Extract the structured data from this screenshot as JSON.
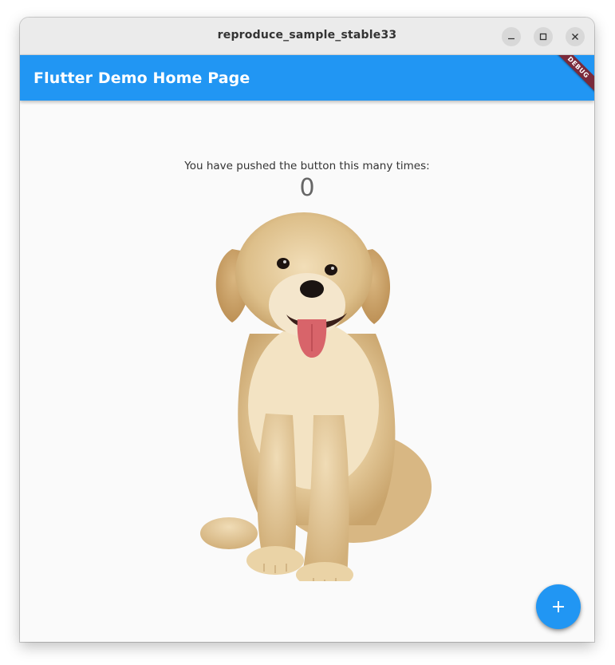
{
  "window": {
    "title": "reproduce_sample_stable33",
    "controls": {
      "minimize_icon": "minimize-icon",
      "maximize_icon": "maximize-icon",
      "close_icon": "close-icon"
    }
  },
  "app_bar": {
    "title": "Flutter Demo Home Page",
    "debug_banner": "DEBUG",
    "color": "#2196f3"
  },
  "body": {
    "caption": "You have pushed the button this many times:",
    "counter": "0",
    "image": "golden-retriever-puppy"
  },
  "fab": {
    "icon": "add-icon",
    "color": "#2196f3"
  }
}
